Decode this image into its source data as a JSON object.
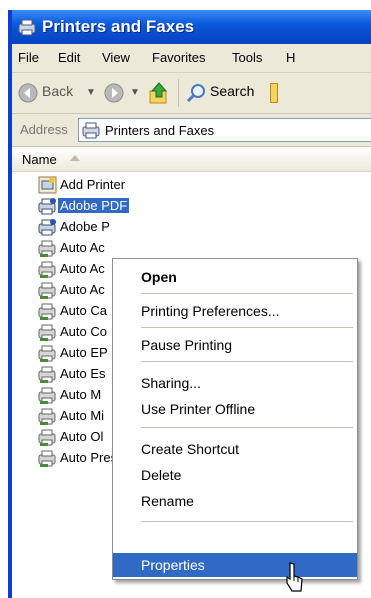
{
  "window": {
    "title": "Printers and Faxes"
  },
  "menubar": {
    "items": [
      "File",
      "Edit",
      "View",
      "Favorites",
      "Tools",
      "H"
    ]
  },
  "toolbar": {
    "back_label": "Back",
    "search_label": "Search"
  },
  "address": {
    "label": "Address",
    "value": "Printers and Faxes"
  },
  "column": {
    "name": "Name"
  },
  "files": [
    {
      "label": "Add Printer",
      "icon": "add-printer-icon"
    },
    {
      "label": "Adobe PDF",
      "icon": "pdf-printer-icon",
      "selected": true
    },
    {
      "label": "Adobe P",
      "icon": "pdf-printer-icon"
    },
    {
      "label": "Auto Ac",
      "icon": "network-printer-icon"
    },
    {
      "label": "Auto Ac",
      "icon": "network-printer-icon"
    },
    {
      "label": "Auto Ac",
      "icon": "network-printer-icon"
    },
    {
      "label": "Auto Ca",
      "icon": "network-printer-icon"
    },
    {
      "label": "Auto Co",
      "icon": "network-printer-icon"
    },
    {
      "label": "Auto EP",
      "icon": "network-printer-icon"
    },
    {
      "label": "Auto Es",
      "icon": "network-printer-icon"
    },
    {
      "label": "Auto M",
      "icon": "network-printer-icon"
    },
    {
      "label": "Auto Mi",
      "icon": "network-printer-icon"
    },
    {
      "label": "Auto Ol",
      "icon": "network-printer-icon"
    },
    {
      "label": "Auto PressRm1612 on NETSO",
      "icon": "network-printer-icon"
    }
  ],
  "context_menu": {
    "open": "Open",
    "printing_preferences": "Printing Preferences...",
    "pause_printing": "Pause Printing",
    "sharing": "Sharing...",
    "use_offline": "Use Printer Offline",
    "create_shortcut": "Create Shortcut",
    "delete": "Delete",
    "rename": "Rename",
    "properties": "Properties"
  },
  "colors": {
    "title_bar": "#0b5be0",
    "selection": "#316ac5",
    "chrome": "#ece9d8"
  }
}
